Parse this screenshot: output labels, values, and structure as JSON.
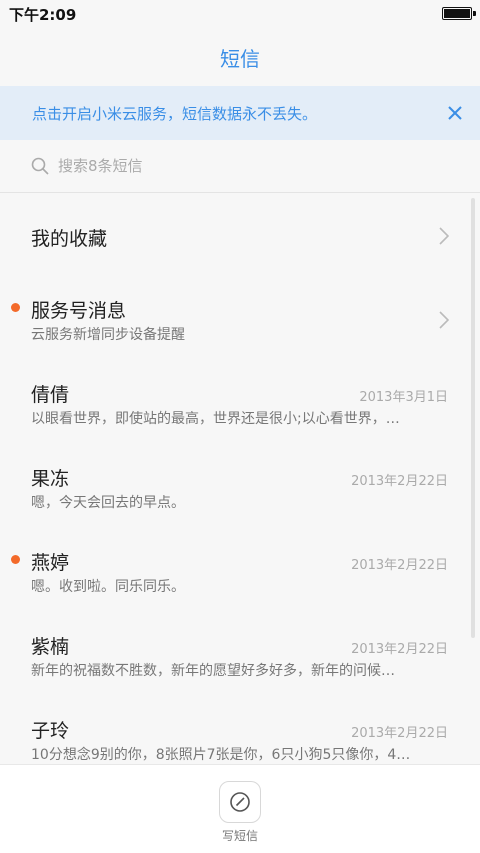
{
  "statusbar": {
    "time": "下午2:09"
  },
  "header": {
    "title": "短信"
  },
  "banner": {
    "text": "点击开启小米云服务，短信数据永不丢失。",
    "close_icon": "close-icon"
  },
  "search": {
    "placeholder": "搜索8条短信",
    "icon": "search-icon"
  },
  "list": {
    "favorites": {
      "label": "我的收藏"
    },
    "items": [
      {
        "name": "服务号消息",
        "preview": "云服务新增同步设备提醒",
        "date": "",
        "unread": true,
        "chevron": true
      },
      {
        "name": "倩倩",
        "preview": "以眼看世界，即使站的最高，世界还是很小;以心看世界，…",
        "date": "2013年3月1日",
        "unread": false
      },
      {
        "name": "果冻",
        "preview": "嗯，今天会回去的早点。",
        "date": "2013年2月22日",
        "unread": false
      },
      {
        "name": "燕婷",
        "preview": "嗯。收到啦。同乐同乐。",
        "date": "2013年2月22日",
        "unread": true
      },
      {
        "name": "紫楠",
        "preview": "新年的祝福数不胜数，新年的愿望好多好多，新年的问候…",
        "date": "2013年2月22日",
        "unread": false
      },
      {
        "name": "子玲",
        "preview": "10分想念9别的你，8张照片7张是你，6只小狗5只像你，4…",
        "date": "2013年2月22日",
        "unread": false
      }
    ]
  },
  "bottombar": {
    "compose_label": "写短信",
    "compose_icon": "compose-icon"
  },
  "colors": {
    "accent": "#3a8ee6",
    "unread_dot": "#f36a2a",
    "banner_bg": "#e3edf8"
  }
}
